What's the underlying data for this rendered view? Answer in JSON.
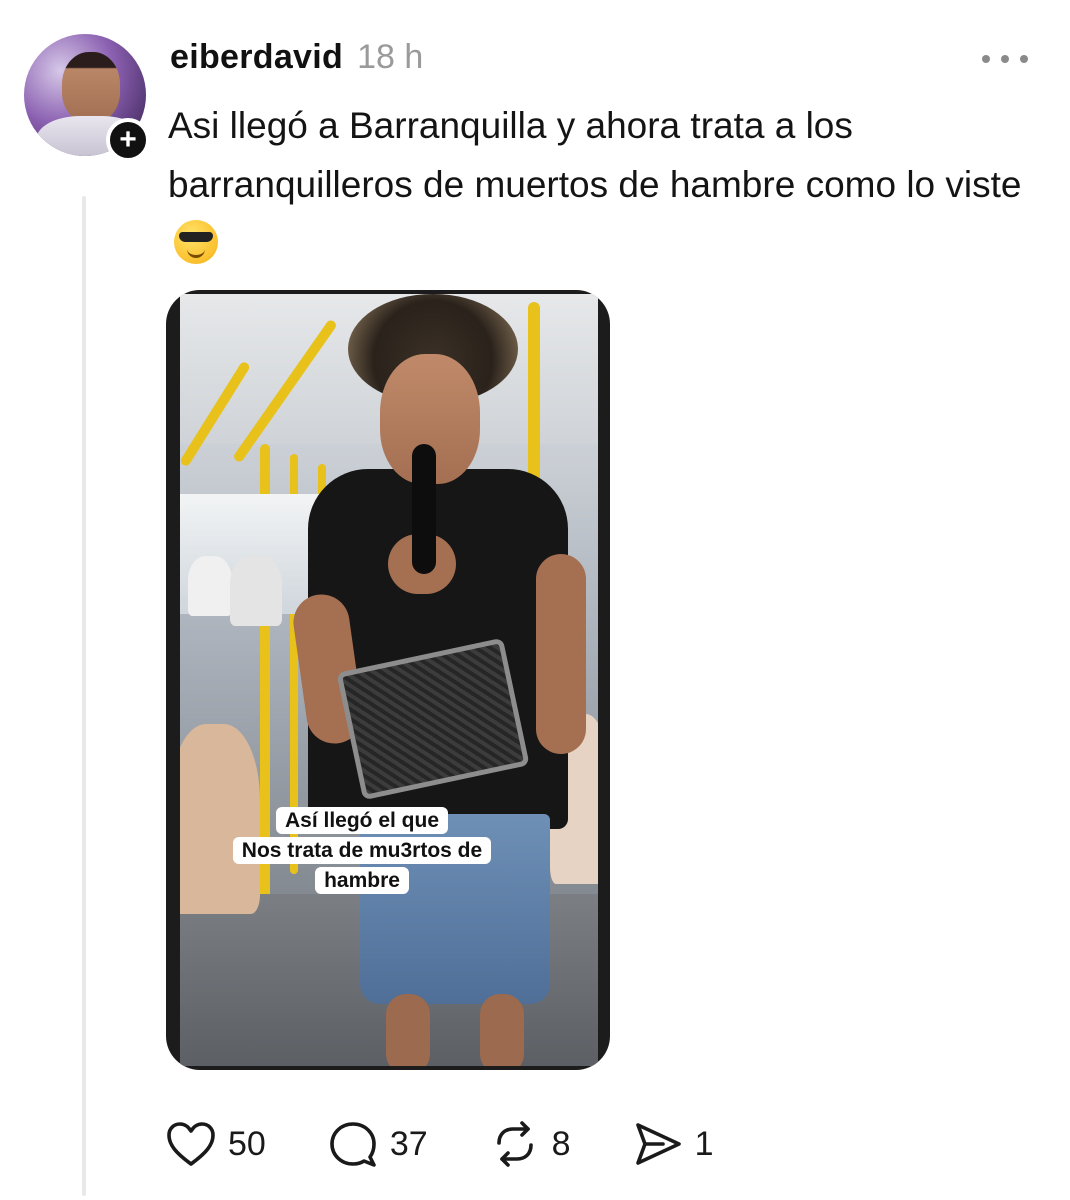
{
  "post": {
    "username": "eiberdavid",
    "timestamp": "18 h",
    "text": "Asi llegó a Barranquilla y ahora trata a los barranquilleros de muertos de hambre como lo viste",
    "emoji": "smiling-face-with-sunglasses",
    "media": {
      "caption_lines": [
        "Así llegó el que",
        "Nos trata de mu3rtos de",
        "hambre"
      ]
    }
  },
  "actions": {
    "likes": "50",
    "replies": "37",
    "reposts": "8",
    "shares": "1"
  },
  "colors": {
    "text": "#141414",
    "muted": "#9a9a9a",
    "icon": "#1a1a1a",
    "thread_line": "#e8e8e8"
  }
}
